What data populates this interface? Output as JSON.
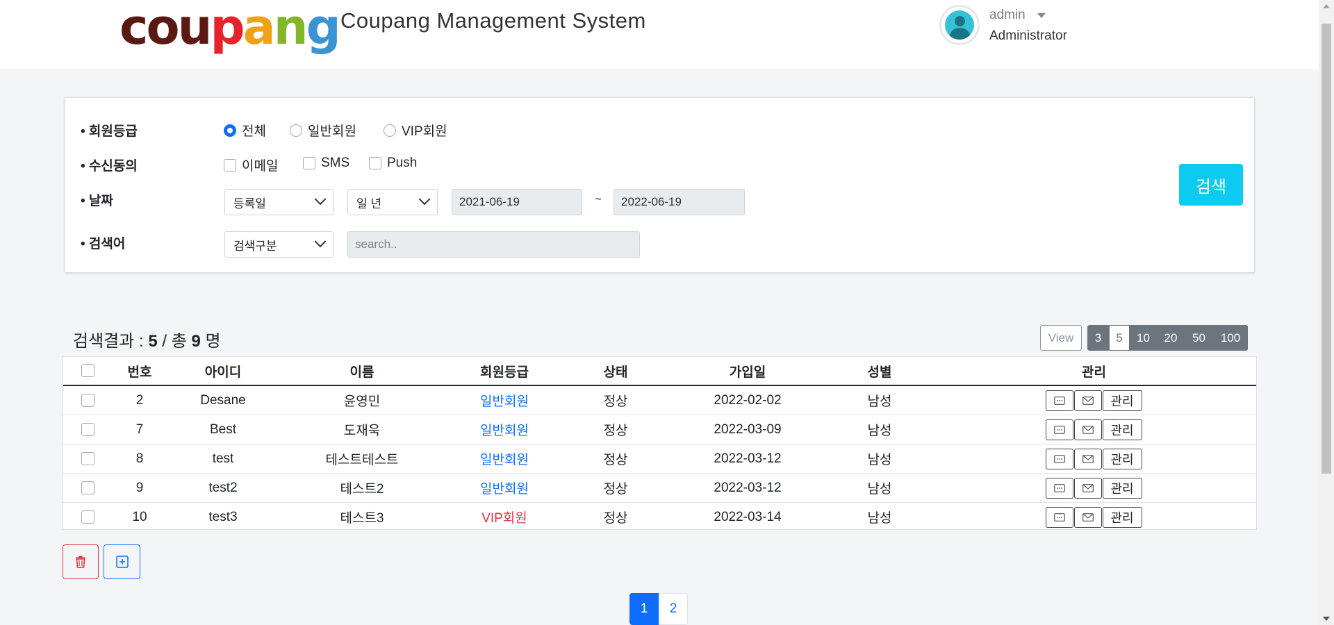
{
  "header": {
    "logo_letters": [
      {
        "ch": "c",
        "color": "#5a1a13"
      },
      {
        "ch": "o",
        "color": "#5a1a13"
      },
      {
        "ch": "u",
        "color": "#5a1a13"
      },
      {
        "ch": "p",
        "color": "#e5232b"
      },
      {
        "ch": "a",
        "color": "#f0a11a"
      },
      {
        "ch": "n",
        "color": "#83b52a"
      },
      {
        "ch": "g",
        "color": "#3a93d3"
      }
    ],
    "title": "Coupang Management System",
    "user_name": "admin",
    "user_role": "Administrator"
  },
  "filters": {
    "grade_label": "• 회원등급",
    "grade_options": [
      "전체",
      "일반회원",
      "VIP회원"
    ],
    "grade_selected": "전체",
    "consent_label": "• 수신동의",
    "consent_options": [
      "이메일",
      "SMS",
      "Push"
    ],
    "date_label": "• 날짜",
    "date_type": "등록일",
    "date_range": "일 년",
    "date_from": "2021-06-19",
    "date_sep": "~",
    "date_to": "2022-06-19",
    "keyword_label": "• 검색어",
    "keyword_type": "검색구분",
    "keyword_placeholder": "search..",
    "search_button": "검색"
  },
  "results": {
    "prefix": "검색결과 : ",
    "count": "5",
    "middle": " / 총 ",
    "total": "9",
    "suffix": " 명",
    "view_label": "View",
    "page_sizes": [
      "3",
      "5",
      "10",
      "20",
      "50",
      "100"
    ],
    "page_size_selected": "5"
  },
  "table": {
    "headers": [
      "번호",
      "아이디",
      "이름",
      "회원등급",
      "상태",
      "가입일",
      "성별",
      "관리"
    ],
    "rows": [
      {
        "no": "2",
        "id": "Desane",
        "name": "윤영민",
        "grade": "일반회원",
        "vip": false,
        "status": "정상",
        "joined": "2022-02-02",
        "gender": "남성"
      },
      {
        "no": "7",
        "id": "Best",
        "name": "도재욱",
        "grade": "일반회원",
        "vip": false,
        "status": "정상",
        "joined": "2022-03-09",
        "gender": "남성"
      },
      {
        "no": "8",
        "id": "test",
        "name": "테스트테스트",
        "grade": "일반회원",
        "vip": false,
        "status": "정상",
        "joined": "2022-03-12",
        "gender": "남성"
      },
      {
        "no": "9",
        "id": "test2",
        "name": "테스트2",
        "grade": "일반회원",
        "vip": false,
        "status": "정상",
        "joined": "2022-03-12",
        "gender": "남성"
      },
      {
        "no": "10",
        "id": "test3",
        "name": "테스트3",
        "grade": "VIP회원",
        "vip": true,
        "status": "정상",
        "joined": "2022-03-14",
        "gender": "남성"
      }
    ],
    "manage_label": "관리"
  },
  "pagination": {
    "pages": [
      "1",
      "2"
    ],
    "current": "1"
  },
  "colors": {
    "primary": "#0d6efd",
    "info": "#0dcaf0",
    "danger": "#dc3545",
    "secondary": "#6c757d"
  }
}
